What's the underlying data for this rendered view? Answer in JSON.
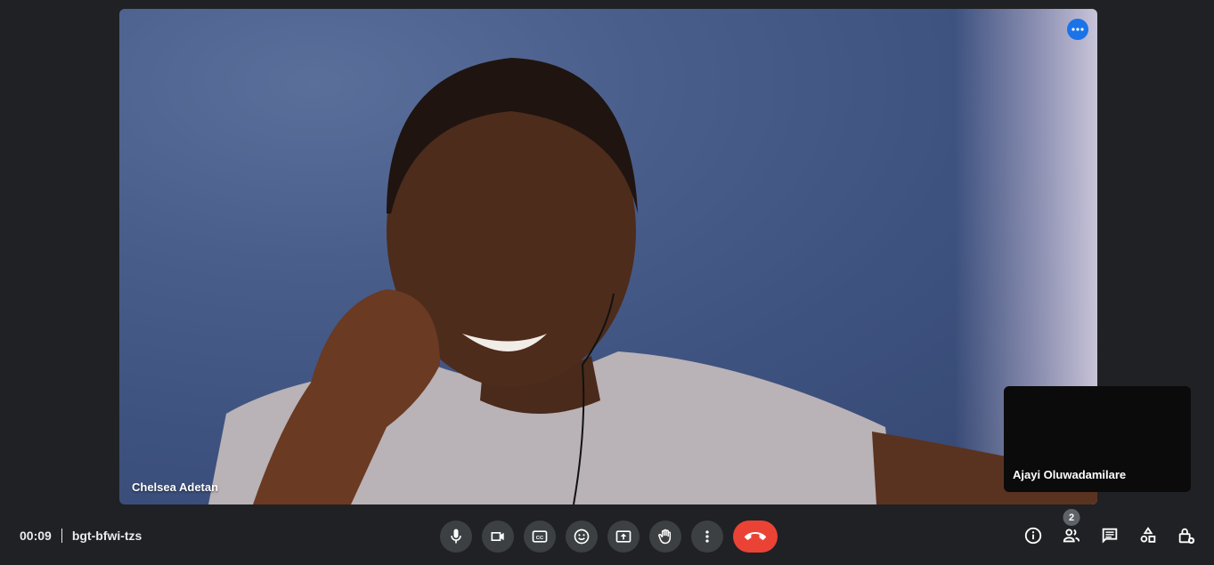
{
  "meeting": {
    "time": "00:09",
    "code": "bgt-bfwi-tzs"
  },
  "main_tile": {
    "participant_name": "Chelsea Adetan",
    "more_options_icon": "more-horiz-icon"
  },
  "self_tile": {
    "participant_name": "Ajayi Oluwadamilare"
  },
  "controls": {
    "buttons": [
      {
        "name": "microphone",
        "icon": "mic-icon"
      },
      {
        "name": "camera",
        "icon": "videocam-icon"
      },
      {
        "name": "captions",
        "icon": "closed-caption-icon"
      },
      {
        "name": "reactions",
        "icon": "emoji-icon"
      },
      {
        "name": "present",
        "icon": "present-screen-icon"
      },
      {
        "name": "raise-hand",
        "icon": "hand-icon"
      },
      {
        "name": "more-options",
        "icon": "more-vert-icon"
      },
      {
        "name": "leave-call",
        "icon": "call-end-icon"
      }
    ]
  },
  "side_panel_buttons": {
    "participants_count": "2",
    "items": [
      "info-icon",
      "people-icon",
      "chat-icon",
      "activities-icon",
      "host-controls-icon"
    ]
  },
  "colors": {
    "background": "#202124",
    "control_bg": "#3c4043",
    "end_call": "#ea4335",
    "accent": "#1a73e8"
  }
}
